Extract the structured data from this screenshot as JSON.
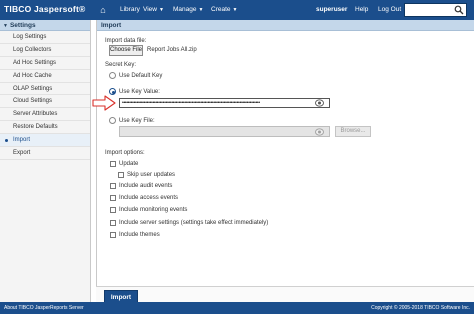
{
  "topbar": {
    "logo": "TIBCO Jaspersoft®",
    "home_icon": "home-icon",
    "nav": {
      "library": "Library",
      "view": "View",
      "manage": "Manage",
      "create": "Create"
    },
    "user": "superuser",
    "help": "Help",
    "logout": "Log Out",
    "search_value": ""
  },
  "sidebar": {
    "title": "Settings",
    "items": [
      {
        "label": "Log Settings"
      },
      {
        "label": "Log Collectors"
      },
      {
        "label": "Ad Hoc Settings"
      },
      {
        "label": "Ad Hoc Cache"
      },
      {
        "label": "OLAP Settings"
      },
      {
        "label": "Cloud Settings"
      },
      {
        "label": "Server Attributes"
      },
      {
        "label": "Restore Defaults"
      },
      {
        "label": "Import"
      },
      {
        "label": "Export"
      }
    ],
    "active_index": 8
  },
  "main": {
    "title": "Import",
    "data_file_label": "Import data file:",
    "choose_file_label": "Choose File",
    "chosen_file": "Report Jobs All.zip",
    "secret_key_label": "Secret Key:",
    "use_default_key": "Use Default Key",
    "use_key_value": "Use Key Value:",
    "key_value": "•••••••••••••••••••••••••••••••••••••••••••••••••••••••••••••••••••••••••••••••••••••••••••••••",
    "use_key_file": "Use Key File:",
    "browse_label": "Browse...",
    "import_options_label": "Import options:",
    "options": {
      "update": "Update",
      "skip_user_updates": "Skip user updates",
      "include_audit_events": "Include audit events",
      "include_access_events": "Include access events",
      "include_monitoring_events": "Include monitoring events",
      "include_server_settings": "Include server settings (settings take effect immediately)",
      "include_themes": "Include themes"
    },
    "import_button": "Import"
  },
  "footer": {
    "left": "About TIBCO JasperReports Server",
    "right": "Copyright © 2005-2018 TIBCO Software Inc."
  },
  "colors": {
    "brand": "#1b4e8c",
    "header_bg": "#c4d7ea",
    "arrow": "#d9312b"
  }
}
